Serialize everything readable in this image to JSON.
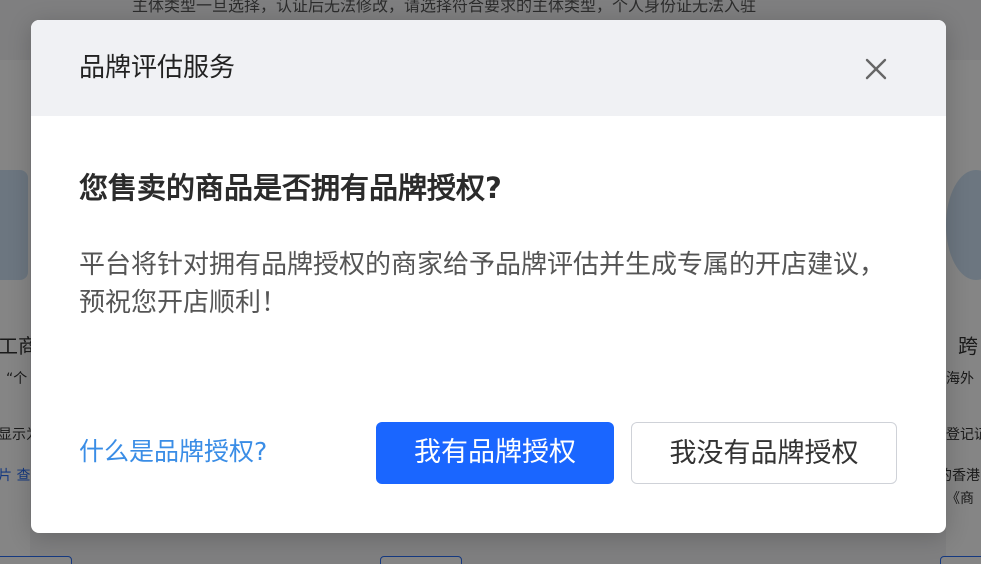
{
  "background": {
    "top_text": "主体类型一旦选择，认证后无法修改，请选择符合要求的主体类型，个人身份证无法入驻",
    "left_fragments": [
      "工商",
      "“个",
      "显示为",
      "片 查"
    ],
    "right_fragments": [
      "跨",
      "海外",
      "登记证",
      "的香港",
      "《商"
    ]
  },
  "modal": {
    "title": "品牌评估服务",
    "question": "您售卖的商品是否拥有品牌授权?",
    "description": "平台将针对拥有品牌授权的商家给予品牌评估并生成专属的开店建议，预祝您开店顺利！",
    "help_link": "什么是品牌授权?",
    "primary_button": "我有品牌授权",
    "secondary_button": "我没有品牌授权"
  },
  "colors": {
    "primary": "#1a66ff",
    "link": "#3a8de6",
    "header_bg": "#f0f1f4"
  },
  "icons": {
    "close": "close-icon"
  }
}
